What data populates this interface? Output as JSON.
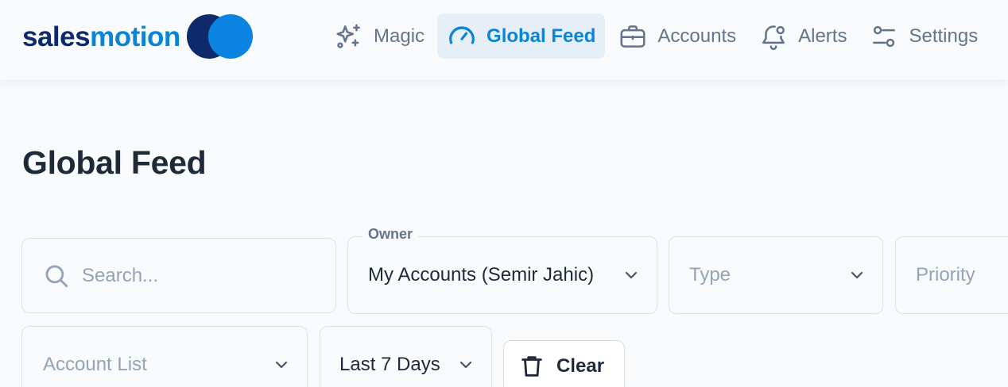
{
  "brand": {
    "part1": "sales",
    "part2": "motion",
    "dark": "#0f2a6b",
    "blue": "#0a84d6"
  },
  "nav": {
    "items": [
      {
        "label": "Magic",
        "icon": "sparkles-icon"
      },
      {
        "label": "Global Feed",
        "icon": "speedometer-icon",
        "active": true
      },
      {
        "label": "Accounts",
        "icon": "briefcase-icon"
      },
      {
        "label": "Alerts",
        "icon": "bell-icon"
      },
      {
        "label": "Settings",
        "icon": "sliders-icon"
      }
    ]
  },
  "page": {
    "title": "Global Feed"
  },
  "filters": {
    "search": {
      "placeholder": "Search..."
    },
    "owner": {
      "label": "Owner",
      "value": "My Accounts (Semir Jahic)"
    },
    "type": {
      "placeholder": "Type"
    },
    "priority": {
      "placeholder": "Priority"
    },
    "account_list": {
      "placeholder": "Account List"
    },
    "date_range": {
      "value": "Last 7 Days"
    },
    "clear_label": "Clear"
  }
}
